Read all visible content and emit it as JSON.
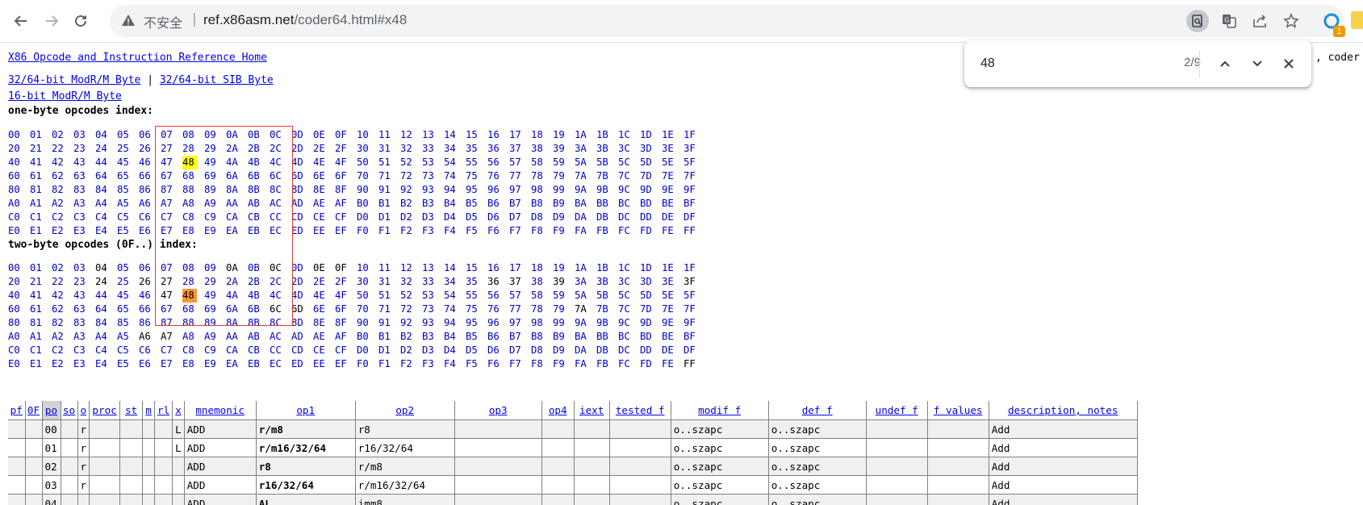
{
  "browser": {
    "security_label": "不安全",
    "url_host": "ref.x86asm.net",
    "url_path": "/coder64.html#x48"
  },
  "find": {
    "query": "48",
    "count": "2/9"
  },
  "page": {
    "home_link": "X86 Opcode and Instruction Reference Home",
    "link_modrm_3264": "32/64-bit ModR/M Byte",
    "separator": "|",
    "link_sib_3264": "32/64-bit SIB Byte",
    "link_modrm_16": "16-bit ModR/M Byte",
    "partial_right": ", coder",
    "one_byte_heading": "one-byte opcodes index:",
    "two_byte_heading": "two-byte opcodes (0F..) index:",
    "hex_digits": "0123456789ABCDEF",
    "one_byte_highlight": "48",
    "two_byte_highlight": "48",
    "two_byte_unlinked": [
      "04",
      "0A",
      "0C",
      "0E",
      "0F",
      "24",
      "26",
      "27",
      "36",
      "37",
      "39",
      "3F",
      "47",
      "6C",
      "6D",
      "7A",
      "A6",
      "A7",
      "FF"
    ]
  },
  "table": {
    "headers": [
      "pf",
      "0F",
      "po",
      "so",
      "o",
      "proc",
      "st",
      "m",
      "rl",
      "x",
      "mnemonic",
      "op1",
      "op2",
      "op3",
      "op4",
      "iext",
      "tested f",
      "modif f",
      "def f",
      "undef f",
      "f values",
      "description, notes"
    ],
    "rows": [
      {
        "po": "00",
        "o": "r",
        "x": "L",
        "mnemonic": "ADD",
        "op1": "r/m8",
        "op2": "r8",
        "modif": "o..szapc",
        "def": "o..szapc",
        "desc": "Add"
      },
      {
        "po": "01",
        "o": "r",
        "x": "L",
        "mnemonic": "ADD",
        "op1": "r/m16/32/64",
        "op2": "r16/32/64",
        "modif": "o..szapc",
        "def": "o..szapc",
        "desc": "Add"
      },
      {
        "po": "02",
        "o": "r",
        "x": "",
        "mnemonic": "ADD",
        "op1": "r8",
        "op2": "r/m8",
        "modif": "o..szapc",
        "def": "o..szapc",
        "desc": "Add"
      },
      {
        "po": "03",
        "o": "r",
        "x": "",
        "mnemonic": "ADD",
        "op1": "r16/32/64",
        "op2": "r/m16/32/64",
        "modif": "o..szapc",
        "def": "o..szapc",
        "desc": "Add"
      },
      {
        "po": "04",
        "o": "",
        "x": "",
        "mnemonic": "ADD",
        "op1": "AL",
        "op2": "imm8",
        "modif": "o..szapc",
        "def": "o..szapc",
        "desc": "Add"
      }
    ]
  }
}
